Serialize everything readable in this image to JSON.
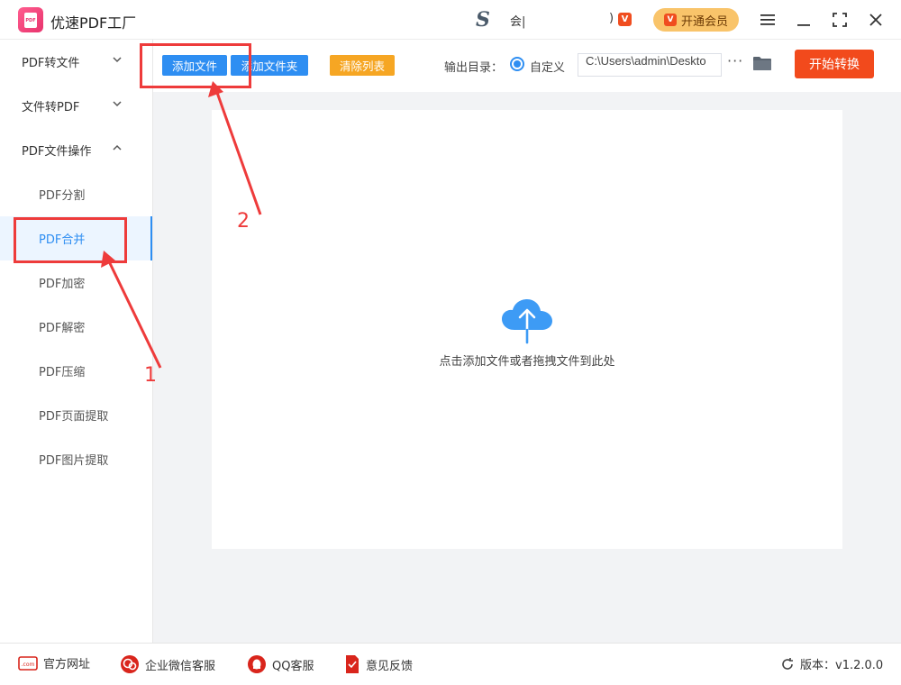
{
  "app": {
    "title": "优速PDF工厂"
  },
  "user": {
    "name_partial": "会|",
    "paren": ")",
    "vip_badge": "V",
    "vip_button": "开通会员",
    "vip_icon": "V"
  },
  "sidebar": {
    "groups": [
      {
        "label": "PDF转文件"
      },
      {
        "label": "文件转PDF"
      },
      {
        "label": "PDF文件操作"
      }
    ],
    "items": [
      {
        "label": "PDF分割"
      },
      {
        "label": "PDF合并"
      },
      {
        "label": "PDF加密"
      },
      {
        "label": "PDF解密"
      },
      {
        "label": "PDF压缩"
      },
      {
        "label": "PDF页面提取"
      },
      {
        "label": "PDF图片提取"
      }
    ],
    "active_item": "PDF合并"
  },
  "toolbar": {
    "add_file": "添加文件",
    "add_folder": "添加文件夹",
    "clear_list": "清除列表",
    "output_label": "输出目录：",
    "radio_label": "自定义",
    "output_path": "C:\\Users\\admin\\Deskto",
    "more": "···",
    "start": "开始转换"
  },
  "drop": {
    "hint": "点击添加文件或者拖拽文件到此处"
  },
  "annotations": {
    "one": "1",
    "two": "2"
  },
  "footer": {
    "website": "官方网址",
    "wechat": "企业微信客服",
    "qq": "QQ客服",
    "feedback": "意见反馈",
    "version": "版本：v1.2.0.0"
  },
  "colors": {
    "accent_blue": "#2e8ef2",
    "start_red": "#f24a1c",
    "clear_orange": "#f6a623",
    "annotation_red": "#ee3b3b",
    "vip_gold": "#f9c46a"
  },
  "icons": [
    "pdf-logo-icon",
    "menu-icon",
    "minimize-icon",
    "maximize-icon",
    "close-icon",
    "chevron-down-icon",
    "chevron-up-icon",
    "folder-icon",
    "cloud-upload-icon",
    "web-icon",
    "wechat-icon",
    "qq-icon",
    "feedback-icon",
    "refresh-icon"
  ]
}
